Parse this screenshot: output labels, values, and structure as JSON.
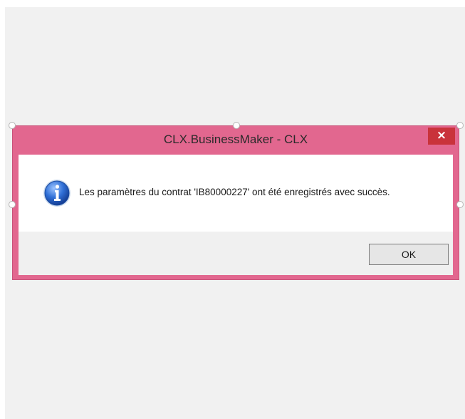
{
  "window": {
    "title": "CLX.BusinessMaker - CLX",
    "close_glyph": "×"
  },
  "message": {
    "icon": "info-icon",
    "text": "Les paramètres du contrat 'IB80000227' ont été enregistrés avec succès."
  },
  "buttons": {
    "ok_label": "OK"
  },
  "colors": {
    "frame": "#e2678f",
    "close_button": "#c9333b",
    "icon_blue": "#2b67c6",
    "canvas": "#f1f1f1"
  }
}
